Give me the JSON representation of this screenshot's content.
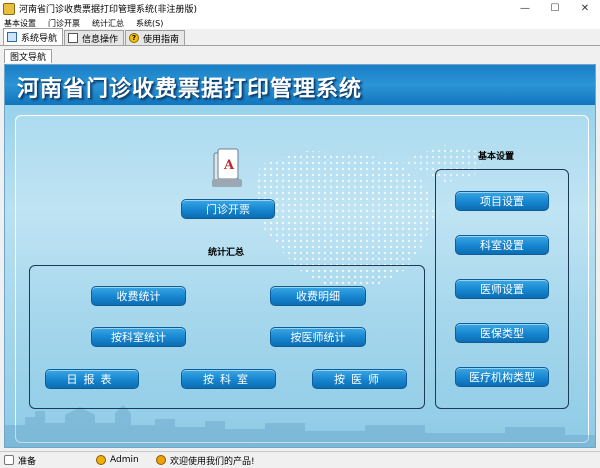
{
  "window": {
    "title": "河南省门诊收费票据打印管理系统(非注册版)",
    "controls": {
      "minimize": "—",
      "maximize": "☐",
      "close": "✕"
    }
  },
  "menu": {
    "items": [
      "基本设置",
      "门诊开票",
      "统计汇总",
      "系统(S)"
    ]
  },
  "toolbar": {
    "tabs": [
      {
        "label": "系统导航",
        "icon": "nav-icon",
        "active": true
      },
      {
        "label": "信息操作",
        "icon": "info-icon",
        "active": false
      },
      {
        "label": "使用指南",
        "icon": "help-icon",
        "icon_text": "?",
        "active": false
      }
    ]
  },
  "subtab": {
    "label": "图文导航"
  },
  "main": {
    "banner_title": "河南省门诊收费票据打印管理系统",
    "outpatient_button": "门诊开票",
    "stats_group": {
      "label": "统计汇总",
      "buttons": [
        "收费统计",
        "收费明细",
        "按科室统计",
        "按医师统计",
        "日报表",
        "按科室",
        "按医师"
      ]
    },
    "basic_group": {
      "label": "基本设置",
      "buttons": [
        "项目设置",
        "科室设置",
        "医师设置",
        "医保类型",
        "医疗机构类型"
      ]
    },
    "doc_icon_letter": "A"
  },
  "status": {
    "ready": "准备",
    "user": "Admin",
    "welcome": "欢迎使用我们的产品!"
  },
  "colors": {
    "banner": "#1a7ec6",
    "button": "#1685cf",
    "background": "#b9e1f2"
  }
}
